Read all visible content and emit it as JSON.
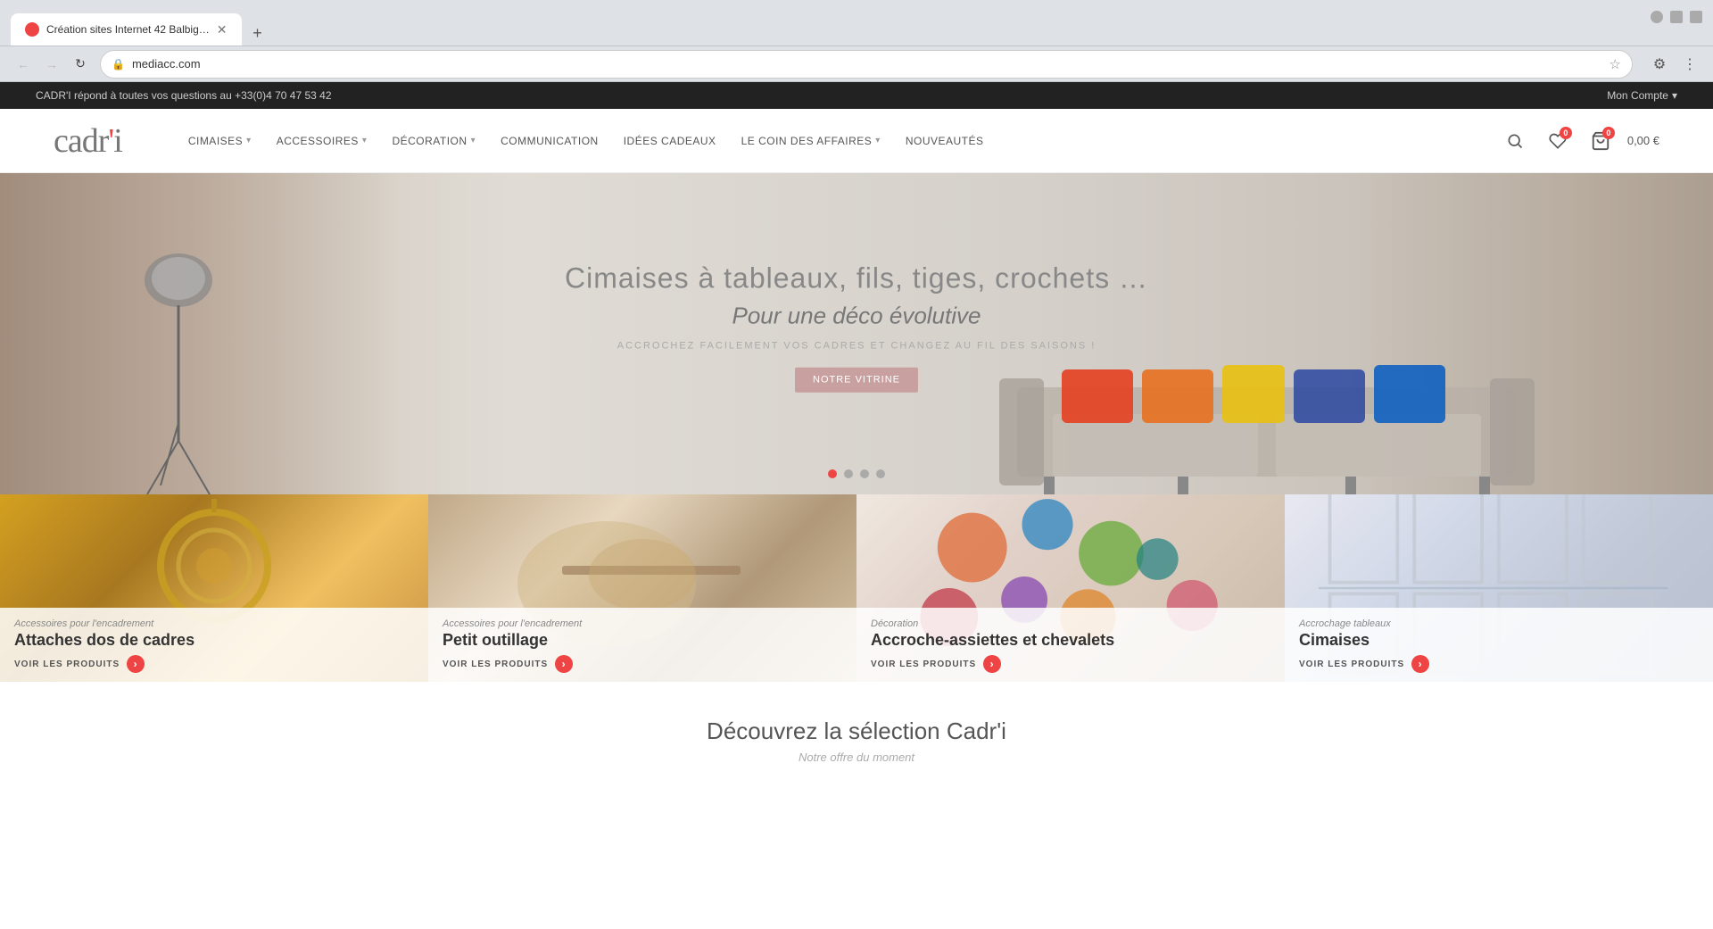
{
  "browser": {
    "tab_title": "Création sites Internet 42 Balbig…",
    "tab_favicon": "♦",
    "url": "mediacc.com",
    "new_tab_icon": "+",
    "back_disabled": false,
    "forward_disabled": true,
    "reload_label": "↻",
    "back_label": "←",
    "forward_label": "→",
    "star_icon": "☆",
    "extensions_icon": "⚙",
    "menu_icon": "⋮"
  },
  "topbar": {
    "message": "CADR'I répond à toutes vos questions au +33(0)4 70 47 53 42",
    "account_label": "Mon Compte",
    "account_chevron": "▾"
  },
  "header": {
    "logo_text": "cadr",
    "logo_accent": "i",
    "logo_apostrophe": "'",
    "nav": [
      {
        "label": "CIMAISES",
        "has_dropdown": true
      },
      {
        "label": "ACCESSOIRES",
        "has_dropdown": true
      },
      {
        "label": "DÉCORATION",
        "has_dropdown": true
      },
      {
        "label": "COMMUNICATION",
        "has_dropdown": false
      },
      {
        "label": "IDÉES CADEAUX",
        "has_dropdown": false
      },
      {
        "label": "LE COIN DES AFFAIRES",
        "has_dropdown": true
      },
      {
        "label": "NOUVEAUTÉS",
        "has_dropdown": false
      }
    ],
    "search_icon": "🔍",
    "wishlist_badge": "0",
    "cart_badge": "0",
    "cart_price": "0,00 €"
  },
  "hero": {
    "title_main": "Cimaises à tableaux, fils, tiges, crochets …",
    "title_sub": "Pour une déco évolutive",
    "tagline": "ACCROCHEZ FACILEMENT VOS CADRES ET CHANGEZ AU FIL DES SAISONS !",
    "cta_label": "NOTRE VITRINE",
    "dots": [
      {
        "active": true
      },
      {
        "active": false
      },
      {
        "active": false
      },
      {
        "active": false
      }
    ]
  },
  "product_cards": [
    {
      "category": "Accessoires pour l'encadrement",
      "title": "Attaches dos de cadres",
      "link_label": "VOIR LES PRODUITS",
      "bg_class": "card-bg-1"
    },
    {
      "category": "Accessoires pour l'encadrement",
      "title": "Petit outillage",
      "link_label": "VOIR LES PRODUITS",
      "bg_class": "card-bg-2"
    },
    {
      "category": "Décoration",
      "title": "Accroche-assiettes et chevalets",
      "link_label": "VOIR LES PRODUITS",
      "bg_class": "card-bg-3"
    },
    {
      "category": "Accrochage tableaux",
      "title": "Cimaises",
      "link_label": "VOIR LES PRODUITS",
      "bg_class": "card-bg-4"
    }
  ],
  "selection": {
    "title": "Découvrez la sélection Cadr'i",
    "subtitle": "Notre offre du moment"
  }
}
